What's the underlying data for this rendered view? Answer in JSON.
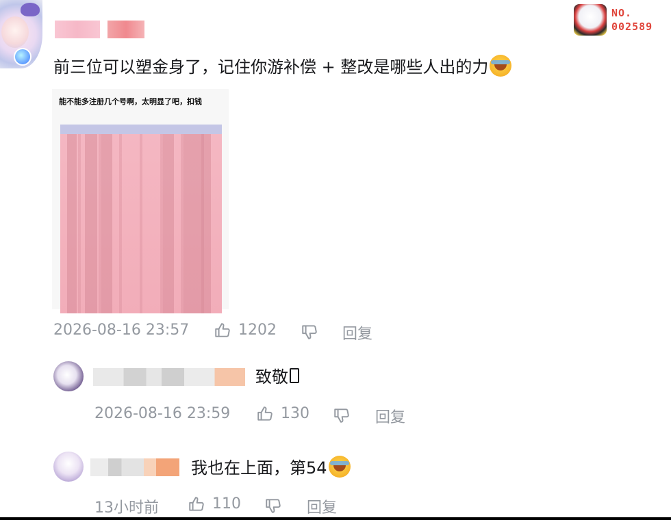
{
  "comment": {
    "sticker": {
      "no_label": "NO.",
      "no_value": "002589"
    },
    "text": "前三位可以塑金身了，记住你游补偿 + 整改是哪些人出的力",
    "attachment_caption": "能不能多注册几个号啊，太明显了吧，扣钱",
    "timestamp": "2026-08-16 23:57",
    "likes": "1202",
    "reply_label": "回复"
  },
  "replies": [
    {
      "text": "致敬",
      "timestamp": "2026-08-16 23:59",
      "likes": "130",
      "reply_label": "回复"
    },
    {
      "text": "我也在上面，第54",
      "timestamp": "13小时前",
      "likes": "110",
      "reply_label": "回复"
    }
  ],
  "icons": {
    "like": "thumb-up-icon",
    "dislike": "thumb-down-icon",
    "emoji": "laugh-cry-emoji-icon"
  },
  "colors": {
    "meta_text": "#9499a0",
    "main_text": "#18191c",
    "sticker_red": "#e0463c"
  }
}
